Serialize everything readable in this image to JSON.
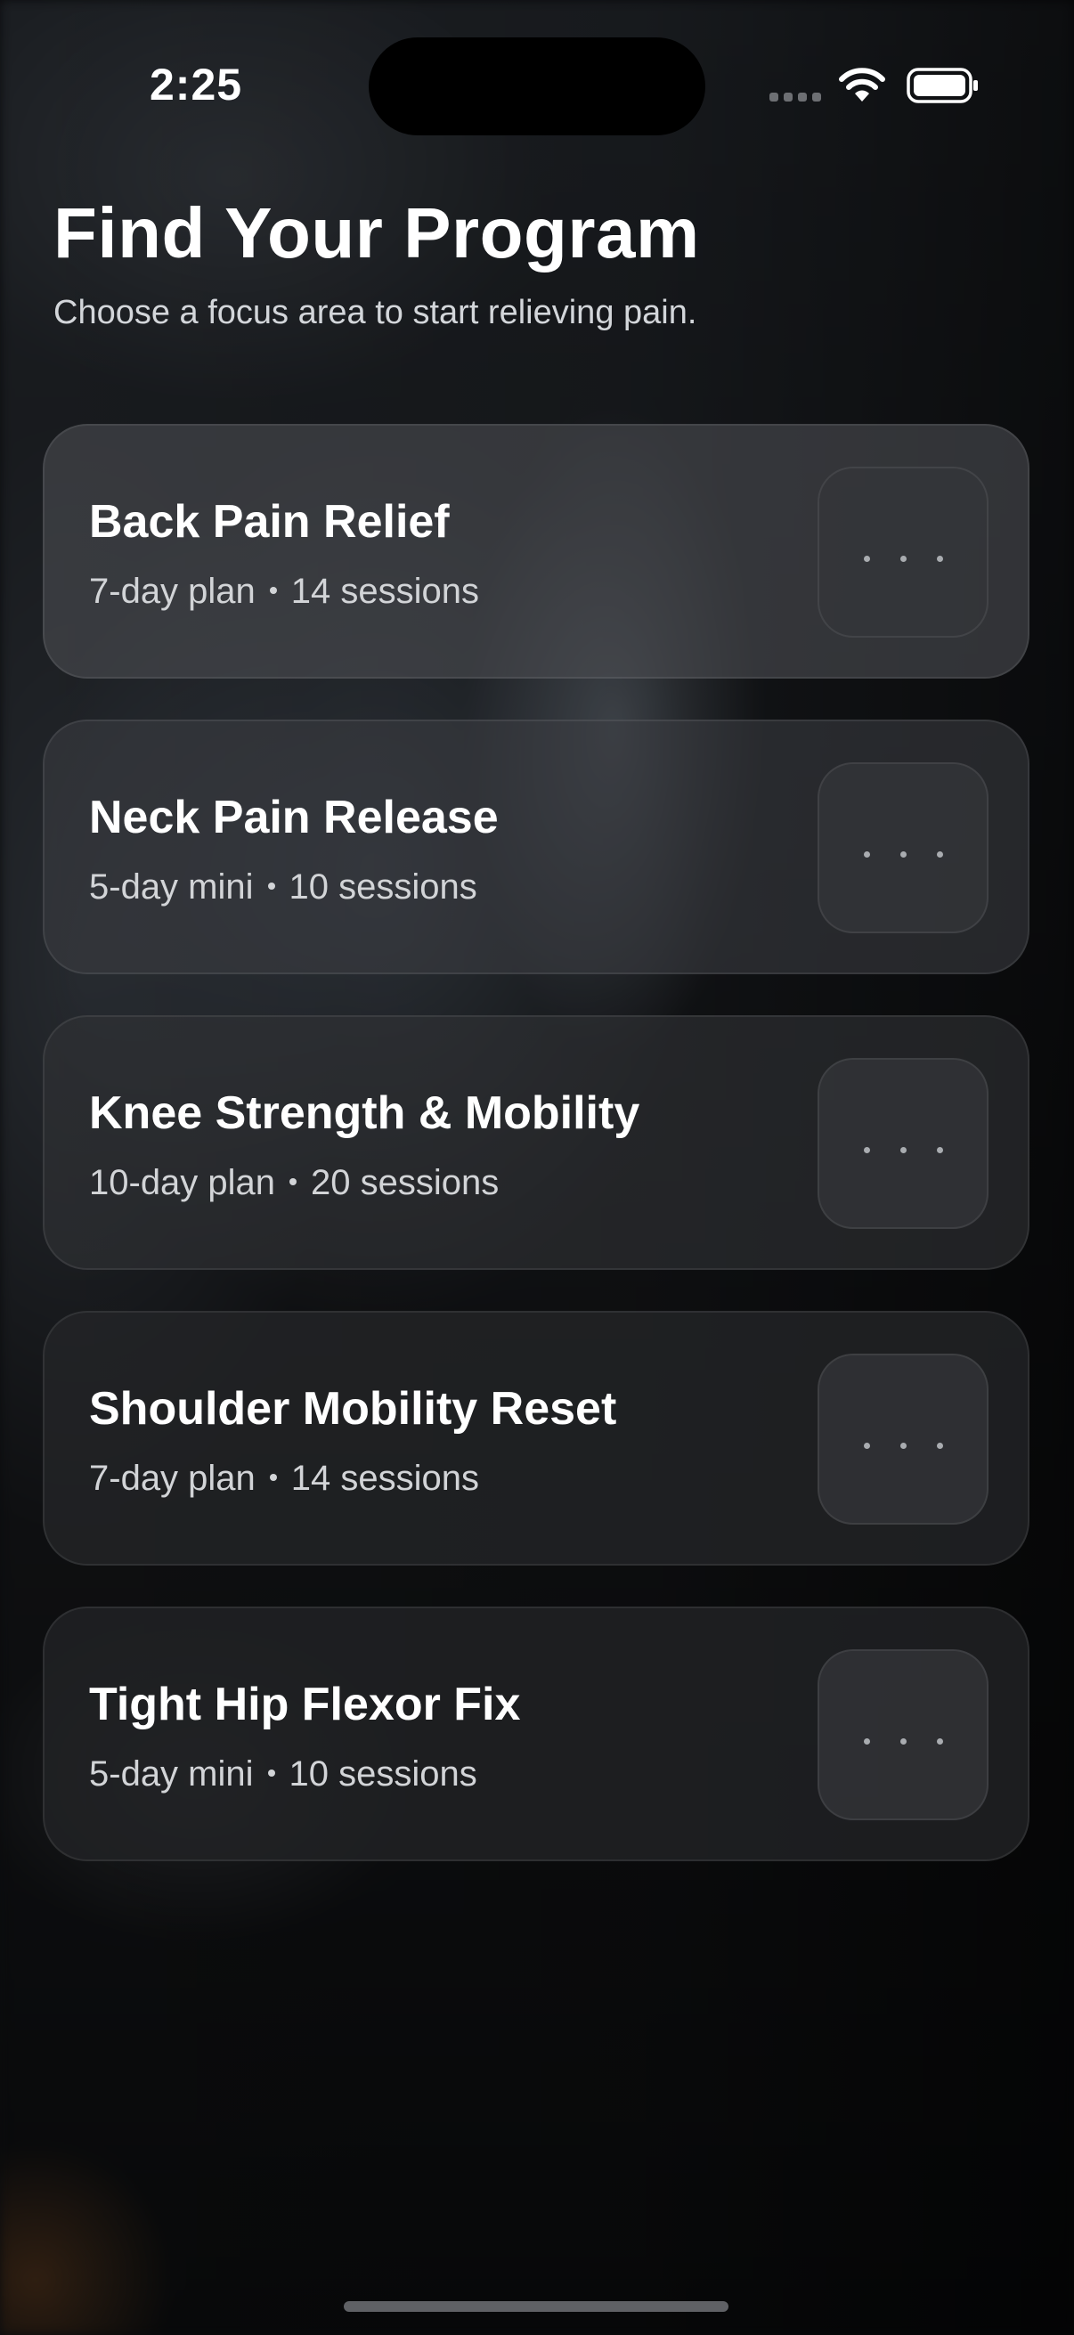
{
  "status_bar": {
    "time": "2:25"
  },
  "header": {
    "title": "Find Your Program",
    "subtitle": "Choose a focus area to start relieving pain."
  },
  "programs": [
    {
      "name": "Back Pain Relief",
      "duration": "7-day plan",
      "sessions": "14 sessions"
    },
    {
      "name": "Neck Pain Release",
      "duration": "5-day mini",
      "sessions": "10 sessions"
    },
    {
      "name": "Knee Strength & Mobility",
      "duration": "10-day plan",
      "sessions": "20 sessions"
    },
    {
      "name": "Shoulder Mobility Reset",
      "duration": "7-day plan",
      "sessions": "14 sessions"
    },
    {
      "name": "Tight Hip Flexor Fix",
      "duration": "5-day mini",
      "sessions": "10 sessions"
    }
  ],
  "icons": {
    "status": [
      "cellular-signal-icon",
      "wifi-icon",
      "battery-icon"
    ],
    "card_action": "more-dots-icon"
  },
  "colors": {
    "background": "#0b0c0e",
    "text_primary": "#ffffff",
    "text_secondary": "#d2d4d7"
  }
}
